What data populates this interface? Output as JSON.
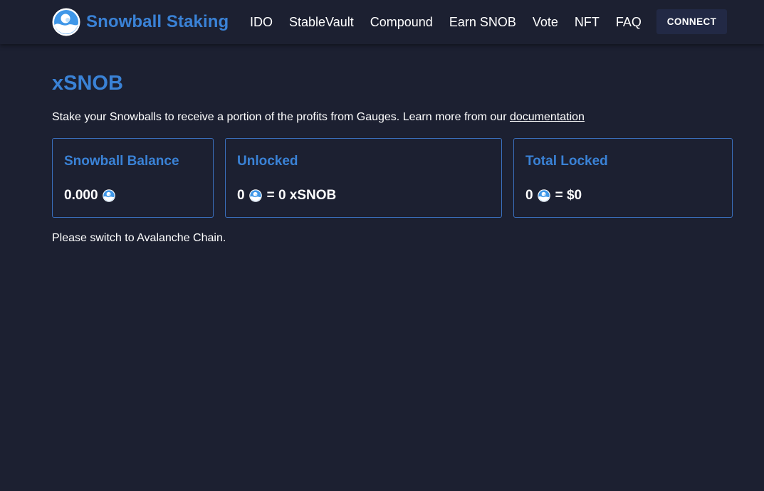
{
  "header": {
    "brand_name": "Snowball Staking",
    "logo_icon": "snowball-logo-icon",
    "nav": [
      {
        "label": "IDO"
      },
      {
        "label": "StableVault"
      },
      {
        "label": "Compound"
      },
      {
        "label": "Earn SNOB"
      },
      {
        "label": "Vote"
      },
      {
        "label": "NFT"
      },
      {
        "label": "FAQ"
      }
    ],
    "connect_label": "CONNECT"
  },
  "main": {
    "title": "xSNOB",
    "intro_text": "Stake your Snowballs to receive a portion of the profits from Gauges. Learn more from our ",
    "intro_link": "documentation",
    "cards": {
      "balance": {
        "title": "Snowball Balance",
        "amount": "0.000",
        "suffix": ""
      },
      "unlocked": {
        "title": "Unlocked",
        "amount": "0",
        "suffix": "= 0 xSNOB"
      },
      "locked": {
        "title": "Total Locked",
        "amount": "0",
        "suffix": "= $0"
      }
    },
    "status_message": "Please switch to Avalanche Chain."
  },
  "colors": {
    "background": "#1c2031",
    "accent": "#3a82d6",
    "card_border": "#3a6fbd",
    "connect_button": "#222945"
  }
}
